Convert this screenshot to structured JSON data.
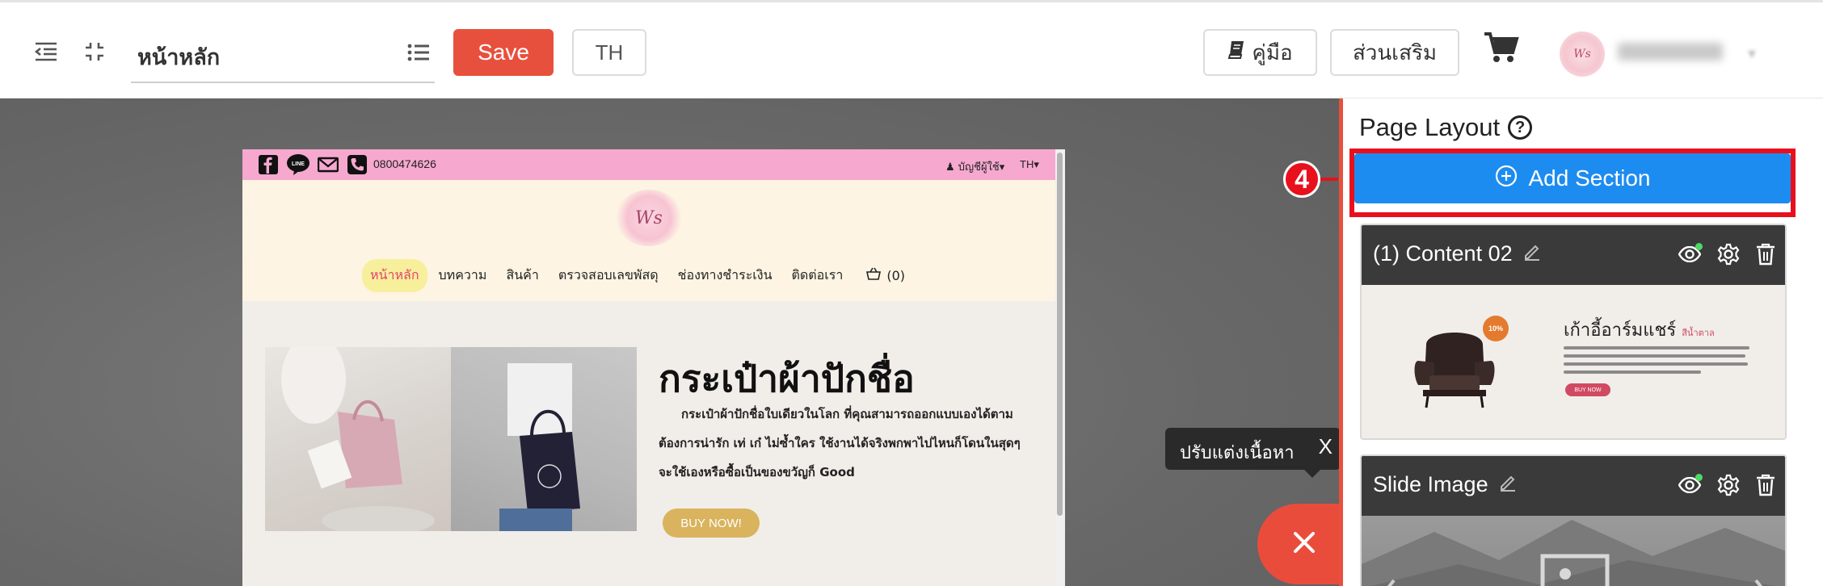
{
  "toolbar": {
    "page_name": "หน้าหลัก",
    "save_label": "Save",
    "lang_label": "TH",
    "manual_label": "คู่มือ",
    "addon_label": "ส่วนเสริม"
  },
  "preview": {
    "phone": "0800474626",
    "account_label": "บัญชีผู้ใช้",
    "lang": "TH",
    "logo_text": "Ws",
    "nav": [
      "หน้าหลัก",
      "บทความ",
      "สินค้า",
      "ตรวจสอบเลขพัสดุ",
      "ช่องทางชำระเงิน",
      "ติดต่อเรา"
    ],
    "cart_count": "(0)",
    "hero_title": "กระเป๋าผ้าปักชื่อ",
    "hero_desc": "กระเป๋าผ้าปักชื่อใบเดียวในโลก ที่คุณสามารถออกแบบเองได้ตามต้องการน่ารัก เท่ เก๋  ไม่ซ้ำใคร ใช้งานได้จริงพกพาไปไหนก็โดนในสุดๆ จะใช้เองหรือซื้อเป็นของขวัญก็ Good",
    "buy_label": "BUY NOW!"
  },
  "tooltip": {
    "text": "ปรับแต่งเนื้อหา",
    "close": "X"
  },
  "panel": {
    "title": "Page Layout",
    "add_section_label": "Add Section",
    "step_number": "4",
    "sections": [
      {
        "name": "(1)  Content 02",
        "thumb_title": "เก้าอี้อาร์มแชร์",
        "thumb_sub": "สีน้ำตาล",
        "thumb_badge": "10%",
        "thumb_buy": "BUY NOW"
      },
      {
        "name": "Slide Image"
      }
    ]
  },
  "colors": {
    "accent_red": "#e8503e",
    "add_section_blue": "#1d8cf0",
    "highlight_red": "#e8101c",
    "preview_pink": "#f6a8cf",
    "buy_gold": "#d9b35d"
  }
}
